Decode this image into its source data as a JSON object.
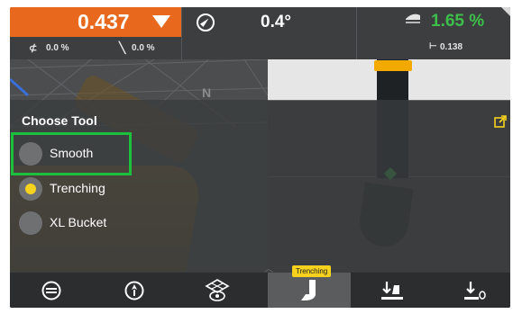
{
  "elevation": {
    "value": "0.437",
    "cross_slope": "0.0 %",
    "main_slope": "0.0 %"
  },
  "heading": {
    "value": "0.4°"
  },
  "bucket": {
    "angle": "1.65 %",
    "width": "0.138"
  },
  "map": {
    "north_label": "N"
  },
  "tool_panel": {
    "title": "Choose Tool",
    "options": [
      {
        "label": "Smooth",
        "selected": false,
        "highlighted": true
      },
      {
        "label": "Trenching",
        "selected": true
      },
      {
        "label": "XL Bucket",
        "selected": false
      }
    ]
  },
  "bottom_bar": {
    "tooltip": "Trenching",
    "buttons": [
      {
        "name": "menu",
        "icon": "menu-dots-icon"
      },
      {
        "name": "gps-status",
        "icon": "gps-status-icon"
      },
      {
        "name": "machine-view",
        "icon": "machine-view-icon"
      },
      {
        "name": "tool-trenching",
        "icon": "bucket-icon",
        "active": true
      },
      {
        "name": "set-elevation",
        "icon": "set-elevation-icon"
      },
      {
        "name": "zero-elevation",
        "icon": "zero-elevation-icon"
      }
    ]
  },
  "colors": {
    "elevation_bar": "#e8691e",
    "bucket_angle": "#3dbf4a",
    "highlight": "#1cc03c",
    "selection": "#f6d21e"
  }
}
